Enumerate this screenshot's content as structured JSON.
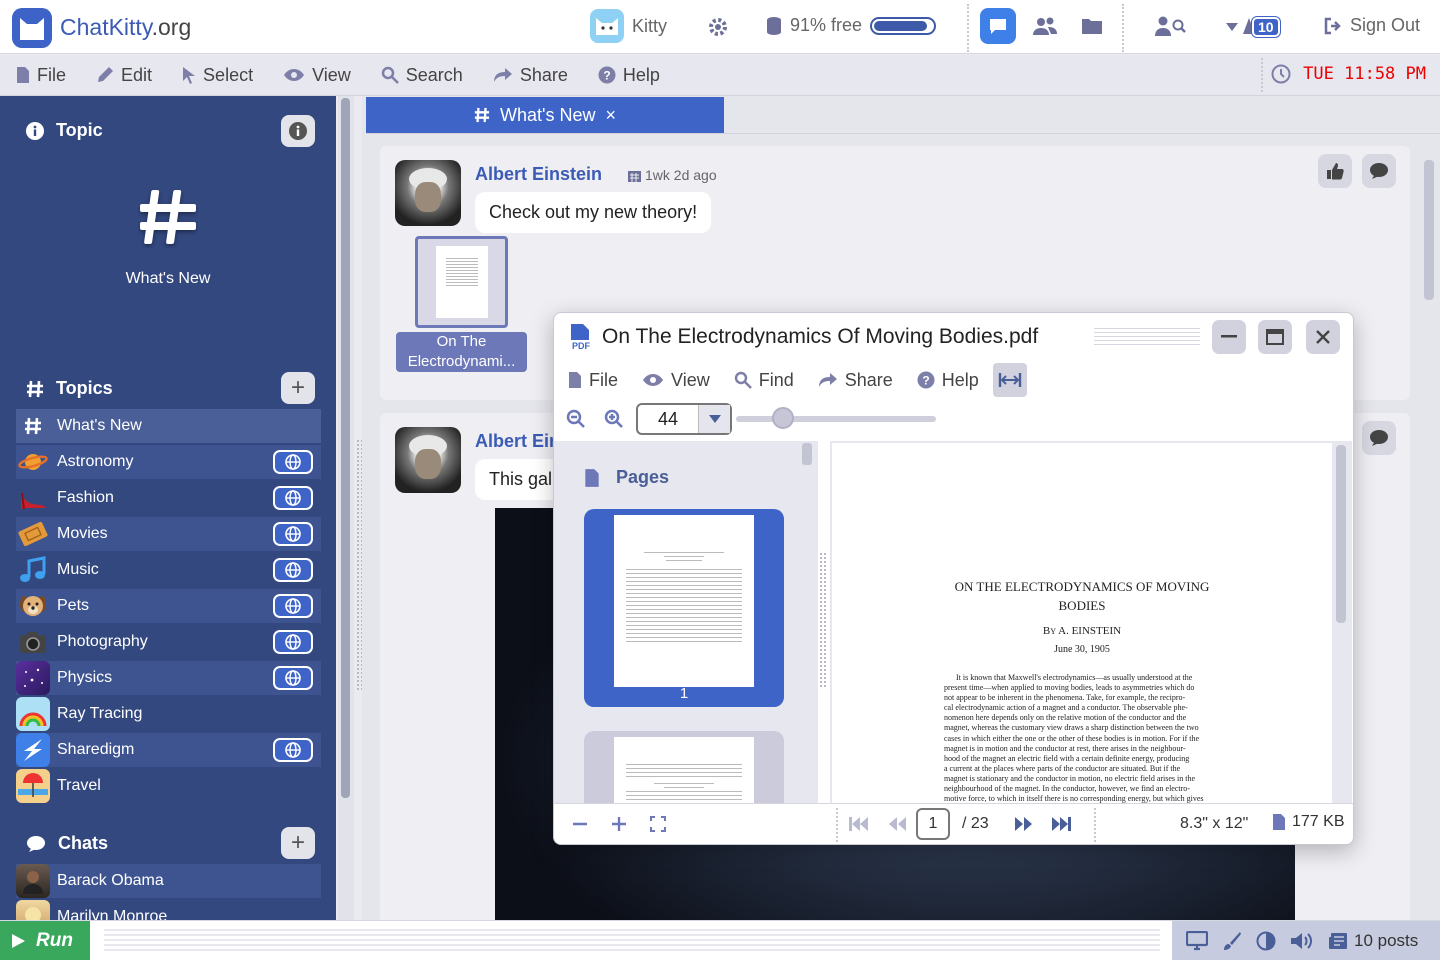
{
  "app": {
    "name": "ChatKitty",
    "domain_suffix": ".org"
  },
  "topbar": {
    "bot_name": "Kitty",
    "storage_text": "91% free",
    "storage_free_fraction": 0.91,
    "notification_count": "10",
    "sign_out_label": "Sign Out"
  },
  "menubar": {
    "items": [
      "File",
      "Edit",
      "Select",
      "View",
      "Search",
      "Share",
      "Help"
    ],
    "clock": "TUE 11:58 PM"
  },
  "sidebar": {
    "topic_header": "Topic",
    "current_topic": "What's New",
    "topics_header": "Topics",
    "topics": [
      {
        "label": "What's New",
        "icon": "hash-icon",
        "public": false
      },
      {
        "label": "Astronomy",
        "icon": "planet-icon",
        "public": true
      },
      {
        "label": "Fashion",
        "icon": "shoe-icon",
        "public": true
      },
      {
        "label": "Movies",
        "icon": "ticket-icon",
        "public": true
      },
      {
        "label": "Music",
        "icon": "music-note-icon",
        "public": true
      },
      {
        "label": "Pets",
        "icon": "dog-icon",
        "public": true
      },
      {
        "label": "Photography",
        "icon": "camera-icon",
        "public": true
      },
      {
        "label": "Physics",
        "icon": "galaxy-icon",
        "public": true
      },
      {
        "label": "Ray Tracing",
        "icon": "rainbow-icon",
        "public": false
      },
      {
        "label": "Sharedigm",
        "icon": "sharedigm-icon",
        "public": true
      },
      {
        "label": "Travel",
        "icon": "beach-icon",
        "public": false
      }
    ],
    "chats_header": "Chats",
    "chats": [
      "Barack Obama",
      "Marilyn Monroe"
    ]
  },
  "main": {
    "tab_label": "What's New",
    "posts": [
      {
        "author": "Albert Einstein",
        "time": "1wk 2d ago",
        "message": "Check out my new theory!",
        "attachment_label": "On The Electrodynami..."
      },
      {
        "author": "Albert Eir",
        "message": "This gal"
      }
    ]
  },
  "pdf": {
    "title": "On The Electrodynamics Of Moving Bodies.pdf",
    "menu": [
      "File",
      "View",
      "Find",
      "Share",
      "Help"
    ],
    "zoom": "44",
    "pages_header": "Pages",
    "thumb_page_number": "1",
    "current_page": "1",
    "total_pages": "/ 23",
    "page_size": "8.3\" x 12\"",
    "file_size": "177 KB",
    "doc_title_line1": "ON THE ELECTRODYNAMICS OF MOVING",
    "doc_title_line2": "BODIES",
    "doc_author": "By A. EINSTEIN",
    "doc_date": "June 30, 1905",
    "doc_body": [
      "It is known that Maxwell's electrodynamics—as usually understood at the",
      "present time—when applied to moving bodies, leads to asymmetries which do",
      "not appear to be inherent in the phenomena. Take, for example, the recipro-",
      "cal electrodynamic action of a magnet and a conductor. The observable phe-",
      "nomenon here depends only on the relative motion of the conductor and the",
      "magnet, whereas the customary view draws a sharp distinction between the two",
      "cases in which either the one or the other of these bodies is in motion. For if the",
      "magnet is in motion and the conductor at rest, there arises in the neighbour-",
      "hood of the magnet an electric field with a certain definite energy, producing",
      "a current at the places where parts of the conductor are situated. But if the",
      "magnet is stationary and the conductor in motion, no electric field arises in the",
      "neighbourhood of the magnet. In the conductor, however, we find an electro-",
      "motive force, to which in itself there is no corresponding energy, but which gives"
    ]
  },
  "bottombar": {
    "run_label": "Run",
    "posts_count": "10 posts"
  }
}
